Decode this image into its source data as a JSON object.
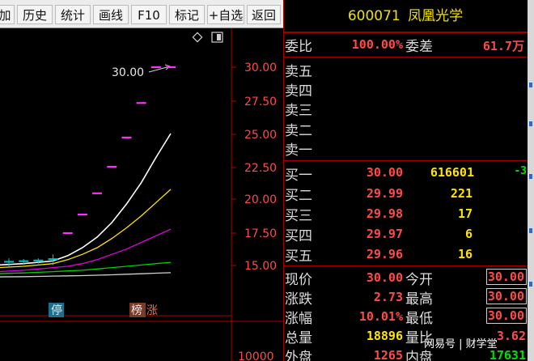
{
  "toolbar": {
    "buttons": [
      {
        "label": "加"
      },
      {
        "label": "历史"
      },
      {
        "label": "统计"
      },
      {
        "label": "画线"
      },
      {
        "label": "F10"
      },
      {
        "label": "标记"
      },
      {
        "label": "+自选"
      },
      {
        "label": "返回"
      }
    ]
  },
  "header": {
    "code": "600071",
    "name": "凤凰光学"
  },
  "chart": {
    "price_axis": [
      "30.00",
      "27.50",
      "25.00",
      "22.50",
      "20.00",
      "17.50",
      "15.00"
    ],
    "volume_label": "10000",
    "peak_label": "30.00",
    "badges": {
      "ting": "停",
      "bang": "榜",
      "zhang": "涨"
    }
  },
  "chart_data": {
    "type": "line",
    "title": "",
    "ylim": [
      14.0,
      31.2
    ],
    "x": [
      1,
      2,
      3,
      4,
      5,
      6,
      7,
      8,
      9,
      10,
      11,
      12
    ],
    "daily_high_marks": {
      "x": [
        5,
        6,
        7,
        8,
        9,
        10,
        11,
        12
      ],
      "values": [
        17.5,
        18.9,
        20.5,
        22.5,
        24.7,
        27.3,
        30.0,
        30.0
      ]
    },
    "candles": [
      {
        "x": 1,
        "open": 15.3,
        "high": 15.6,
        "low": 15.0,
        "close": 15.4
      },
      {
        "x": 2,
        "open": 15.35,
        "high": 15.55,
        "low": 15.1,
        "close": 15.45
      },
      {
        "x": 3,
        "open": 15.4,
        "high": 15.6,
        "low": 15.2,
        "close": 15.5
      },
      {
        "x": 4,
        "open": 15.5,
        "high": 15.9,
        "low": 15.1,
        "close": 15.6
      }
    ],
    "series": [
      {
        "values": [
          15.1,
          15.2,
          15.3,
          15.4,
          15.8,
          16.4,
          17.2,
          18.3,
          19.7,
          21.3,
          23.2,
          25.0
        ]
      },
      {
        "values": [
          14.9,
          15.0,
          15.1,
          15.2,
          15.5,
          15.9,
          16.4,
          17.1,
          17.9,
          18.8,
          19.8,
          20.8
        ]
      },
      {
        "values": [
          14.6,
          14.7,
          14.8,
          14.9,
          15.0,
          15.2,
          15.5,
          15.9,
          16.3,
          16.8,
          17.3,
          17.8
        ]
      },
      {
        "values": [
          14.45,
          14.5,
          14.55,
          14.6,
          14.65,
          14.7,
          14.8,
          14.9,
          15.0,
          15.1,
          15.2,
          15.3
        ]
      },
      {
        "values": [
          14.2,
          14.22,
          14.24,
          14.26,
          14.28,
          14.3,
          14.33,
          14.36,
          14.4,
          14.44,
          14.48,
          14.52
        ]
      }
    ]
  },
  "orderbook": {
    "weibi_label": "委比",
    "weibi_value": "100.00%",
    "weicha_label": "委差",
    "weicha_value": "61.7万",
    "sells": [
      {
        "label": "卖五"
      },
      {
        "label": "卖四"
      },
      {
        "label": "卖三"
      },
      {
        "label": "卖二"
      },
      {
        "label": "卖一"
      }
    ],
    "buys": [
      {
        "label": "买一",
        "price": "30.00",
        "volume": "616601",
        "change": "-3"
      },
      {
        "label": "买二",
        "price": "29.99",
        "volume": "221"
      },
      {
        "label": "买三",
        "price": "29.98",
        "volume": "17"
      },
      {
        "label": "买四",
        "price": "29.97",
        "volume": "6"
      },
      {
        "label": "买五",
        "price": "29.96",
        "volume": "16"
      }
    ]
  },
  "quote": {
    "xianjia_label": "现价",
    "xianjia": "30.00",
    "jinkai_label": "今开",
    "jinkai": "30.00",
    "zhangdie_label": "涨跌",
    "zhangdie": "2.73",
    "zuigao_label": "最高",
    "zuigao": "30.00",
    "zhangfu_label": "涨幅",
    "zhangfu": "10.01%",
    "zuidi_label": "最低",
    "zuidi": "30.00",
    "zongliang_label": "总量",
    "zongliang": "18896",
    "liangbi_label": "量比",
    "liangbi": "3.62",
    "waipan_label": "外盘",
    "waipan": "1265",
    "neipan_label": "内盘",
    "neipan": "17631"
  },
  "watermark": "网易号 | 财学堂",
  "colors": {
    "up": "#ff4a4a",
    "ma1": "#ffffff",
    "ma2": "#ffe400",
    "ma3": "#e000e0",
    "ma4": "#00d000",
    "ma5": "#d0d0d0",
    "grid": "#a00000",
    "candle": "#00c8c8"
  }
}
